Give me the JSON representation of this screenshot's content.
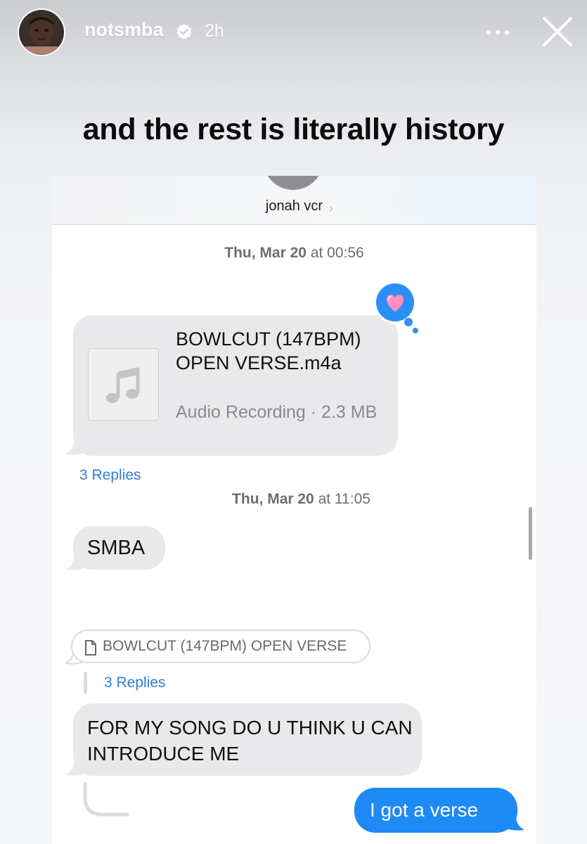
{
  "story": {
    "username": "notsmba",
    "time_ago": "2h",
    "caption": "and the rest is literally history",
    "icons": {
      "verified": "verified-badge-icon",
      "more": "more-horizontal-icon",
      "close": "close-icon"
    }
  },
  "conversation": {
    "contact_name": "jonah vcr",
    "contact_chevron": "›",
    "timestamps": [
      {
        "day": "Thu, Mar 20",
        "time": " at 00:56"
      },
      {
        "day": "Thu, Mar 20",
        "time": " at 11:05"
      }
    ],
    "attachment": {
      "file_name": "BOWLCUT (147BPM) OPEN VERSE.m4a",
      "meta": "Audio Recording · 2.3 MB",
      "icon": "music-note-icon",
      "tapback": "heart-icon"
    },
    "replies_1": "3 Replies",
    "message_smba": "SMBA",
    "quote": {
      "text": "BOWLCUT (147BPM) OPEN VERSE",
      "icon": "document-icon"
    },
    "replies_2": "3 Replies",
    "message_song": "FOR MY SONG DO U THINK U CAN INTRODUCE ME",
    "message_sent": "I got a verse"
  },
  "colors": {
    "sent_bubble": "#1d8af5",
    "received_bubble": "#e9e9eb",
    "link": "#2f7fd6",
    "tapback_bg": "#2c8ef7"
  }
}
